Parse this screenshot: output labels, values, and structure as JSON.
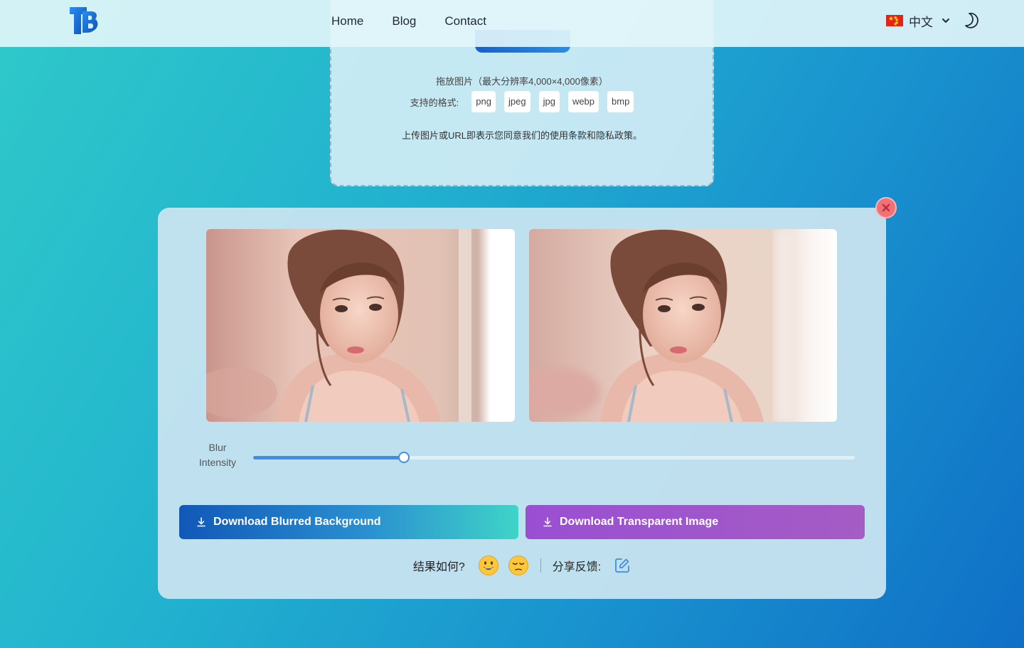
{
  "header": {
    "nav": [
      {
        "label": "Home"
      },
      {
        "label": "Blog"
      },
      {
        "label": "Contact"
      }
    ],
    "language": {
      "label": "中文",
      "icon": "china-flag-icon"
    },
    "theme_toggle_icon": "moon-icon",
    "logo_icon": "tb-logo-icon",
    "colors": {
      "logo": "#1a73e8"
    }
  },
  "upload": {
    "hint": "拖放图片（最大分辨率4,000×4,000像素）",
    "formats_label": "支持的格式:",
    "formats": [
      "png",
      "jpeg",
      "jpg",
      "webp",
      "bmp"
    ],
    "terms": "上传图片或URL即表示您同意我们的使用条款和隐私政策。"
  },
  "result": {
    "slider": {
      "label_line1": "Blur",
      "label_line2": "Intensity",
      "value": 0.25
    },
    "download_blurred": "Download Blurred Background",
    "download_transparent": "Download Transparent Image",
    "feedback": {
      "question": "结果如何?",
      "share": "分享反馈:",
      "emoji_good": "grinning-face-icon",
      "emoji_bad": "unamused-face-icon"
    },
    "close_icon": "close-icon"
  },
  "colors": {
    "accent_blue": "#3f8fe6",
    "purple": "#9a4fd2",
    "close_red": "#f07178"
  }
}
